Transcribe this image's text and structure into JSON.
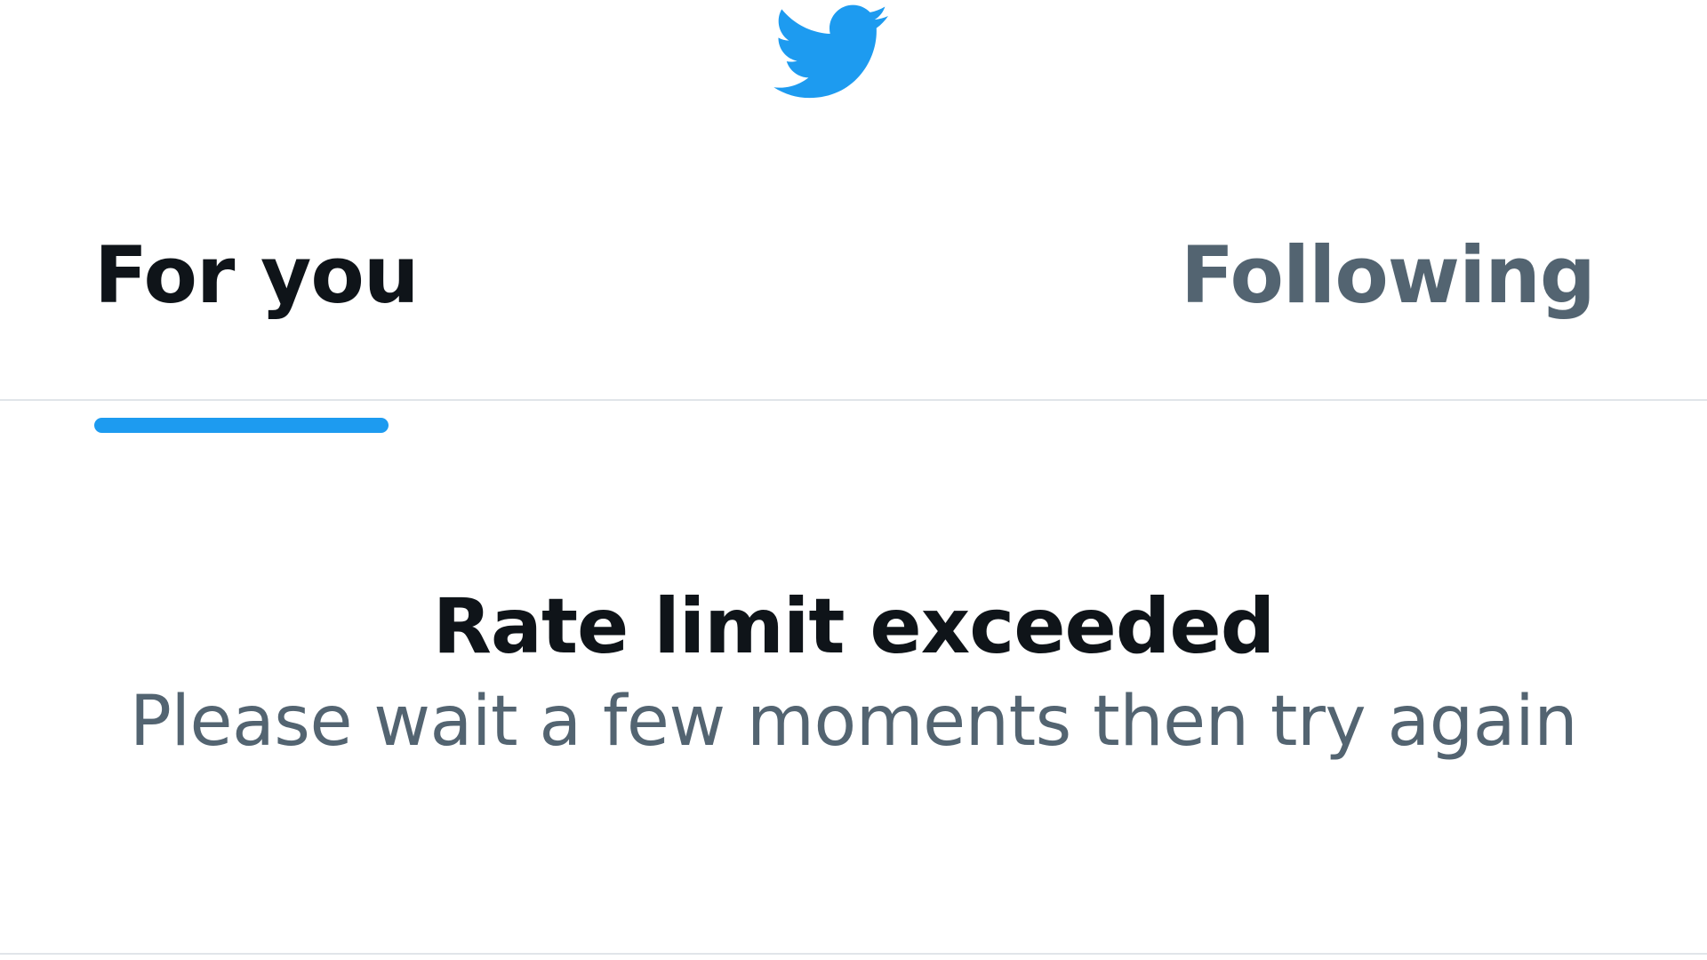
{
  "header": {
    "logo_icon": "twitter-bird-icon",
    "brand_color": "#1d9bf0"
  },
  "tabs": [
    {
      "label": "For you",
      "active": true
    },
    {
      "label": "Following",
      "active": false
    }
  ],
  "message": {
    "title": "Rate limit exceeded",
    "subtitle": "Please wait a few moments then try again"
  },
  "colors": {
    "primary_text": "#0f1419",
    "secondary_text": "#536471",
    "accent": "#1d9bf0",
    "divider": "#e1e5e9"
  }
}
